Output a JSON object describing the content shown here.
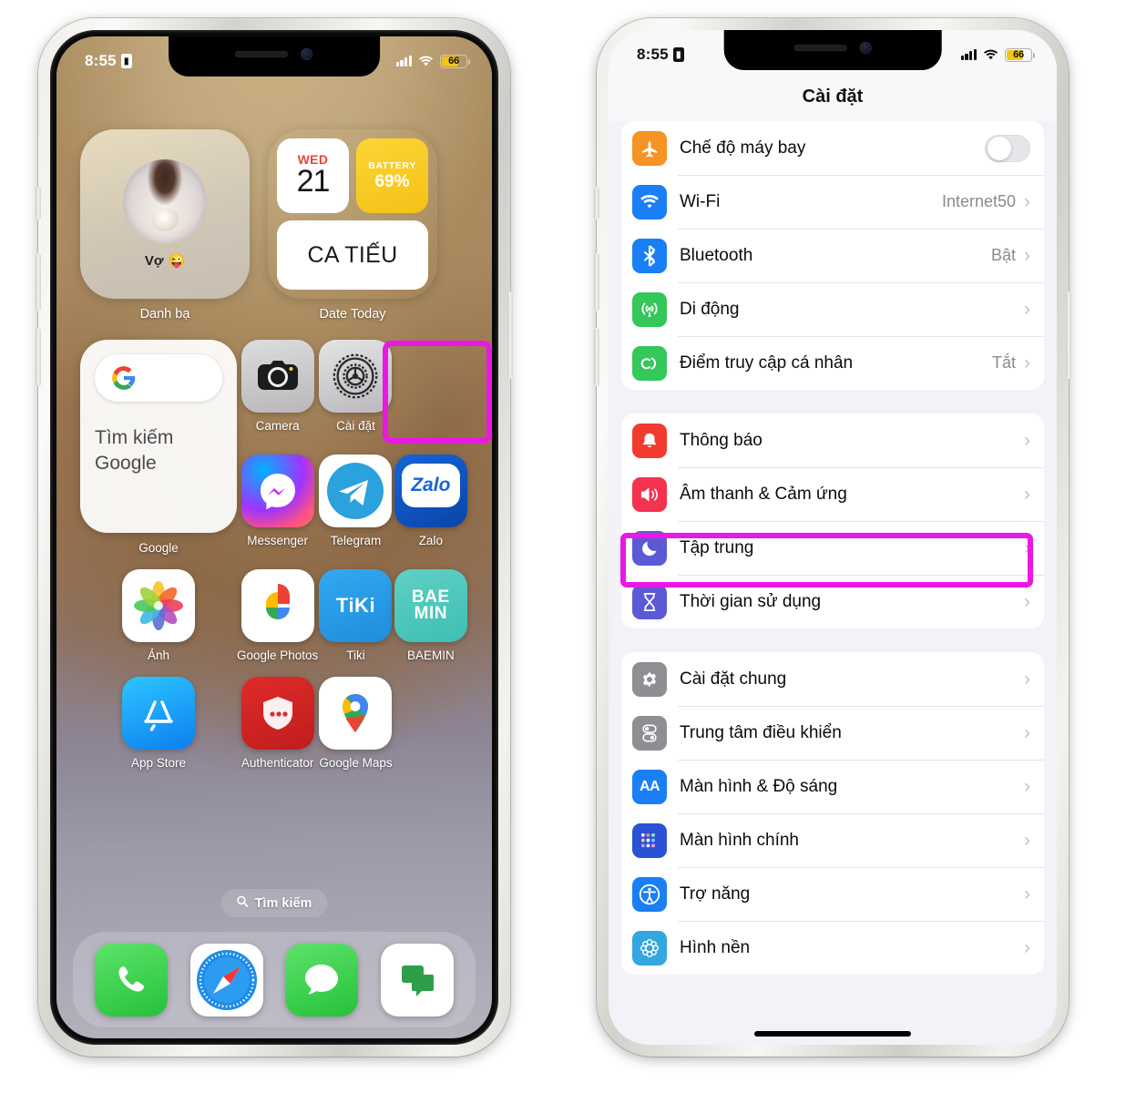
{
  "status_bar": {
    "time": "8:55",
    "lock_icon": "portrait-orientation-lock-icon",
    "signal_icon": "cellular-signal-icon",
    "wifi_icon": "wifi-icon",
    "battery_percent": "66",
    "battery_color": "#f3c514"
  },
  "home_screen": {
    "widgets": [
      {
        "label": "Danh bạ",
        "contact_name": "Vợ",
        "contact_emoji": "😜",
        "type": "contacts"
      },
      {
        "label": "Date Today",
        "day_of_week": "WED",
        "day_number": "21",
        "battery_title": "BATTERY",
        "battery_value": "69%",
        "bottom_text": "CA TIẾU",
        "type": "date"
      }
    ],
    "google_widget": {
      "label": "Google",
      "search_line1": "Tìm kiếm",
      "search_line2": "Google",
      "icon": "google-g-icon"
    },
    "apps": [
      {
        "label": "Camera",
        "icon": "camera-icon"
      },
      {
        "label": "Cài đặt",
        "icon": "settings-gear-icon",
        "highlighted": true
      },
      {
        "label": "Messenger",
        "icon": "messenger-icon"
      },
      {
        "label": "Telegram",
        "icon": "telegram-icon"
      },
      {
        "label": "Zalo",
        "icon": "zalo-icon"
      },
      {
        "label": "Ảnh",
        "icon": "photos-icon"
      },
      {
        "label": "Google Photos",
        "icon": "google-photos-icon"
      },
      {
        "label": "Tiki",
        "icon": "tiki-icon"
      },
      {
        "label": "BAEMIN",
        "icon": "baemin-icon"
      },
      {
        "label": "App Store",
        "icon": "app-store-icon"
      },
      {
        "label": "Authenticator",
        "icon": "authenticator-shield-icon"
      },
      {
        "label": "Google Maps",
        "icon": "google-maps-pin-icon"
      }
    ],
    "search_pill": {
      "label": "Tìm kiếm",
      "icon": "search-icon"
    },
    "dock": [
      {
        "label": "Phone",
        "icon": "phone-handset-icon"
      },
      {
        "label": "Safari",
        "icon": "safari-compass-icon"
      },
      {
        "label": "Messages",
        "icon": "messages-bubble-icon"
      },
      {
        "label": "Chat",
        "icon": "chat-bubbles-icon"
      }
    ]
  },
  "settings_screen": {
    "title": "Cài đặt",
    "groups": [
      {
        "rows": [
          {
            "label": "Chế độ máy bay",
            "icon": "airplane-icon",
            "icon_color": "#f59324",
            "control": "toggle",
            "toggle_on": false
          },
          {
            "label": "Wi-Fi",
            "icon": "wifi-icon",
            "icon_color": "#1a7ef4",
            "value": "Internet50",
            "control": "chevron"
          },
          {
            "label": "Bluetooth",
            "icon": "bluetooth-icon",
            "icon_color": "#1a7ef4",
            "value": "Bật",
            "control": "chevron"
          },
          {
            "label": "Di động",
            "icon": "cellular-antenna-icon",
            "icon_color": "#34c759",
            "value": "",
            "control": "chevron"
          },
          {
            "label": "Điểm truy cập cá nhân",
            "icon": "hotspot-link-icon",
            "icon_color": "#34c759",
            "value": "Tắt",
            "control": "chevron"
          }
        ]
      },
      {
        "rows": [
          {
            "label": "Thông báo",
            "icon": "bell-icon",
            "icon_color": "#f03b2e",
            "control": "chevron"
          },
          {
            "label": "Âm thanh & Cảm ứng",
            "icon": "speaker-icon",
            "icon_color": "#f3334f",
            "control": "chevron",
            "highlighted": true
          },
          {
            "label": "Tập trung",
            "icon": "moon-icon",
            "icon_color": "#5c59d6",
            "control": "chevron"
          },
          {
            "label": "Thời gian sử dụng",
            "icon": "hourglass-icon",
            "icon_color": "#5c59d6",
            "control": "chevron"
          }
        ]
      },
      {
        "rows": [
          {
            "label": "Cài đặt chung",
            "icon": "gear-icon",
            "icon_color": "#8e8e93",
            "control": "chevron"
          },
          {
            "label": "Trung tâm điều khiển",
            "icon": "control-toggles-icon",
            "icon_color": "#8e8e93",
            "control": "chevron"
          },
          {
            "label": "Màn hình & Độ sáng",
            "icon": "display-aa-icon",
            "icon_color": "#1a7ef4",
            "control": "chevron"
          },
          {
            "label": "Màn hình chính",
            "icon": "home-screen-grid-icon",
            "icon_color": "#2b52d4",
            "control": "chevron"
          },
          {
            "label": "Trợ năng",
            "icon": "accessibility-icon",
            "icon_color": "#1a7ef4",
            "control": "chevron"
          },
          {
            "label": "Hình nền",
            "icon": "wallpaper-flower-icon",
            "icon_color": "#34a6e0",
            "control": "chevron"
          }
        ]
      }
    ]
  },
  "highlight_color": "#ea18e4"
}
